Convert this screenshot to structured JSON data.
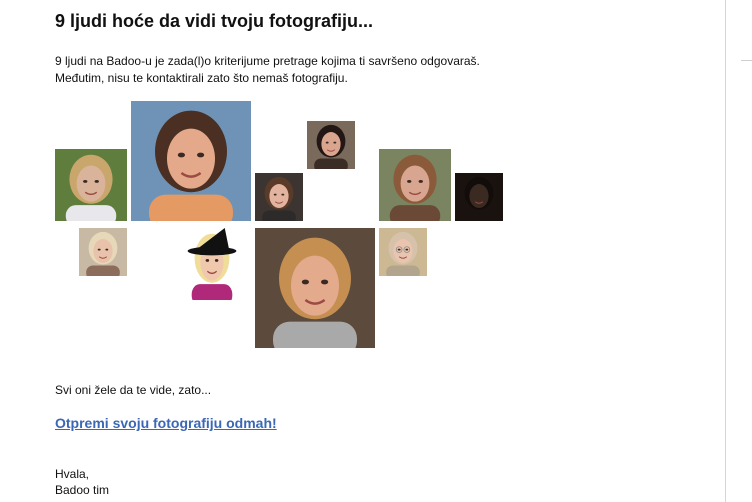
{
  "email": {
    "title": "9 ljudi hoće da vidi tvoju fotografiju...",
    "intro_lines": [
      "9 ljudi na Badoo-u je zada(l)o kriterijume pretrage kojima ti savršeno odgovaraš.",
      "Međutim, nisu te kontaktirali zato što nemaš fotografiju."
    ],
    "photos": [
      {
        "name": "profile-photo-1",
        "desc": "woman-outdoors",
        "skin": "#d9b49a",
        "hair": "#c9a66b",
        "bg": "#5f7d3c",
        "shirt": "#e8e8ec"
      },
      {
        "name": "profile-photo-2",
        "desc": "woman-dark-hair-smiling",
        "skin": "#e4a98a",
        "hair": "#4a2f22",
        "bg": "#6f93b6",
        "shirt": "#e49a62"
      },
      {
        "name": "profile-photo-3",
        "desc": "woman-brown-hair",
        "skin": "#e2b4a0",
        "hair": "#5a3a28",
        "bg": "#3c3430",
        "shirt": "#2d2a2a"
      },
      {
        "name": "profile-photo-4",
        "desc": "woman-dark-hair-close",
        "skin": "#d9a58e",
        "hair": "#221714",
        "bg": "#7a6a5c",
        "shirt": "#3b2c26"
      },
      {
        "name": "profile-photo-5",
        "desc": "woman-short-hair",
        "skin": "#d8a690",
        "hair": "#8a5a3a",
        "bg": "#7b8460",
        "shirt": "#6a4a36"
      },
      {
        "name": "profile-photo-6",
        "desc": "dark-photo",
        "skin": "#3a2a22",
        "hair": "#120c0a",
        "bg": "#1a120f",
        "shirt": "#1a120f"
      },
      {
        "name": "profile-photo-7",
        "desc": "woman-blonde-older",
        "skin": "#e8c2aa",
        "hair": "#e6d8b8",
        "bg": "#c7b9a3",
        "shirt": "#8c6c5a"
      },
      {
        "name": "profile-photo-8",
        "desc": "woman-witch-hat",
        "skin": "#f0c8ae",
        "hair": "#f1dd9a",
        "bg": "#ffffff",
        "shirt": "#b0287a"
      },
      {
        "name": "profile-photo-9",
        "desc": "woman-blonde-large",
        "skin": "#e4aa8c",
        "hair": "#c58f52",
        "bg": "#5c4a3c",
        "shirt": "#a9a9a9"
      },
      {
        "name": "profile-photo-10",
        "desc": "woman-glasses",
        "skin": "#e9c4ae",
        "hair": "#d6c2aa",
        "bg": "#cdb894",
        "shirt": "#b3a48e"
      }
    ],
    "cta_text": "Svi oni žele da te vide, zato...",
    "cta_link": "Otpremi svoju fotografiju odmah!",
    "signoff_lines": [
      "Hvala,",
      "Badoo tim"
    ]
  }
}
